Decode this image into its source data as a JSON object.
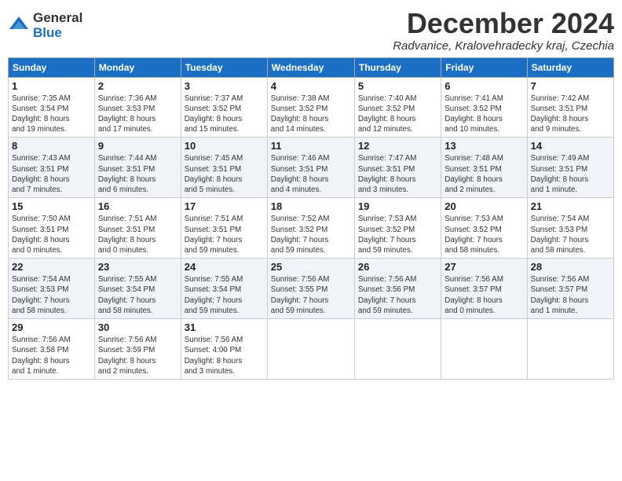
{
  "logo": {
    "general": "General",
    "blue": "Blue"
  },
  "title": "December 2024",
  "location": "Radvanice, Kralovehradecky kraj, Czechia",
  "days_of_week": [
    "Sunday",
    "Monday",
    "Tuesday",
    "Wednesday",
    "Thursday",
    "Friday",
    "Saturday"
  ],
  "weeks": [
    [
      {
        "day": "1",
        "info": "Sunrise: 7:35 AM\nSunset: 3:54 PM\nDaylight: 8 hours\nand 19 minutes."
      },
      {
        "day": "2",
        "info": "Sunrise: 7:36 AM\nSunset: 3:53 PM\nDaylight: 8 hours\nand 17 minutes."
      },
      {
        "day": "3",
        "info": "Sunrise: 7:37 AM\nSunset: 3:52 PM\nDaylight: 8 hours\nand 15 minutes."
      },
      {
        "day": "4",
        "info": "Sunrise: 7:38 AM\nSunset: 3:52 PM\nDaylight: 8 hours\nand 14 minutes."
      },
      {
        "day": "5",
        "info": "Sunrise: 7:40 AM\nSunset: 3:52 PM\nDaylight: 8 hours\nand 12 minutes."
      },
      {
        "day": "6",
        "info": "Sunrise: 7:41 AM\nSunset: 3:52 PM\nDaylight: 8 hours\nand 10 minutes."
      },
      {
        "day": "7",
        "info": "Sunrise: 7:42 AM\nSunset: 3:51 PM\nDaylight: 8 hours\nand 9 minutes."
      }
    ],
    [
      {
        "day": "8",
        "info": "Sunrise: 7:43 AM\nSunset: 3:51 PM\nDaylight: 8 hours\nand 7 minutes."
      },
      {
        "day": "9",
        "info": "Sunrise: 7:44 AM\nSunset: 3:51 PM\nDaylight: 8 hours\nand 6 minutes."
      },
      {
        "day": "10",
        "info": "Sunrise: 7:45 AM\nSunset: 3:51 PM\nDaylight: 8 hours\nand 5 minutes."
      },
      {
        "day": "11",
        "info": "Sunrise: 7:46 AM\nSunset: 3:51 PM\nDaylight: 8 hours\nand 4 minutes."
      },
      {
        "day": "12",
        "info": "Sunrise: 7:47 AM\nSunset: 3:51 PM\nDaylight: 8 hours\nand 3 minutes."
      },
      {
        "day": "13",
        "info": "Sunrise: 7:48 AM\nSunset: 3:51 PM\nDaylight: 8 hours\nand 2 minutes."
      },
      {
        "day": "14",
        "info": "Sunrise: 7:49 AM\nSunset: 3:51 PM\nDaylight: 8 hours\nand 1 minute."
      }
    ],
    [
      {
        "day": "15",
        "info": "Sunrise: 7:50 AM\nSunset: 3:51 PM\nDaylight: 8 hours\nand 0 minutes."
      },
      {
        "day": "16",
        "info": "Sunrise: 7:51 AM\nSunset: 3:51 PM\nDaylight: 8 hours\nand 0 minutes."
      },
      {
        "day": "17",
        "info": "Sunrise: 7:51 AM\nSunset: 3:51 PM\nDaylight: 7 hours\nand 59 minutes."
      },
      {
        "day": "18",
        "info": "Sunrise: 7:52 AM\nSunset: 3:52 PM\nDaylight: 7 hours\nand 59 minutes."
      },
      {
        "day": "19",
        "info": "Sunrise: 7:53 AM\nSunset: 3:52 PM\nDaylight: 7 hours\nand 59 minutes."
      },
      {
        "day": "20",
        "info": "Sunrise: 7:53 AM\nSunset: 3:52 PM\nDaylight: 7 hours\nand 58 minutes."
      },
      {
        "day": "21",
        "info": "Sunrise: 7:54 AM\nSunset: 3:53 PM\nDaylight: 7 hours\nand 58 minutes."
      }
    ],
    [
      {
        "day": "22",
        "info": "Sunrise: 7:54 AM\nSunset: 3:53 PM\nDaylight: 7 hours\nand 58 minutes."
      },
      {
        "day": "23",
        "info": "Sunrise: 7:55 AM\nSunset: 3:54 PM\nDaylight: 7 hours\nand 58 minutes."
      },
      {
        "day": "24",
        "info": "Sunrise: 7:55 AM\nSunset: 3:54 PM\nDaylight: 7 hours\nand 59 minutes."
      },
      {
        "day": "25",
        "info": "Sunrise: 7:56 AM\nSunset: 3:55 PM\nDaylight: 7 hours\nand 59 minutes."
      },
      {
        "day": "26",
        "info": "Sunrise: 7:56 AM\nSunset: 3:56 PM\nDaylight: 7 hours\nand 59 minutes."
      },
      {
        "day": "27",
        "info": "Sunrise: 7:56 AM\nSunset: 3:57 PM\nDaylight: 8 hours\nand 0 minutes."
      },
      {
        "day": "28",
        "info": "Sunrise: 7:56 AM\nSunset: 3:57 PM\nDaylight: 8 hours\nand 1 minute."
      }
    ],
    [
      {
        "day": "29",
        "info": "Sunrise: 7:56 AM\nSunset: 3:58 PM\nDaylight: 8 hours\nand 1 minute."
      },
      {
        "day": "30",
        "info": "Sunrise: 7:56 AM\nSunset: 3:59 PM\nDaylight: 8 hours\nand 2 minutes."
      },
      {
        "day": "31",
        "info": "Sunrise: 7:56 AM\nSunset: 4:00 PM\nDaylight: 8 hours\nand 3 minutes."
      },
      {
        "day": "",
        "info": ""
      },
      {
        "day": "",
        "info": ""
      },
      {
        "day": "",
        "info": ""
      },
      {
        "day": "",
        "info": ""
      }
    ]
  ]
}
